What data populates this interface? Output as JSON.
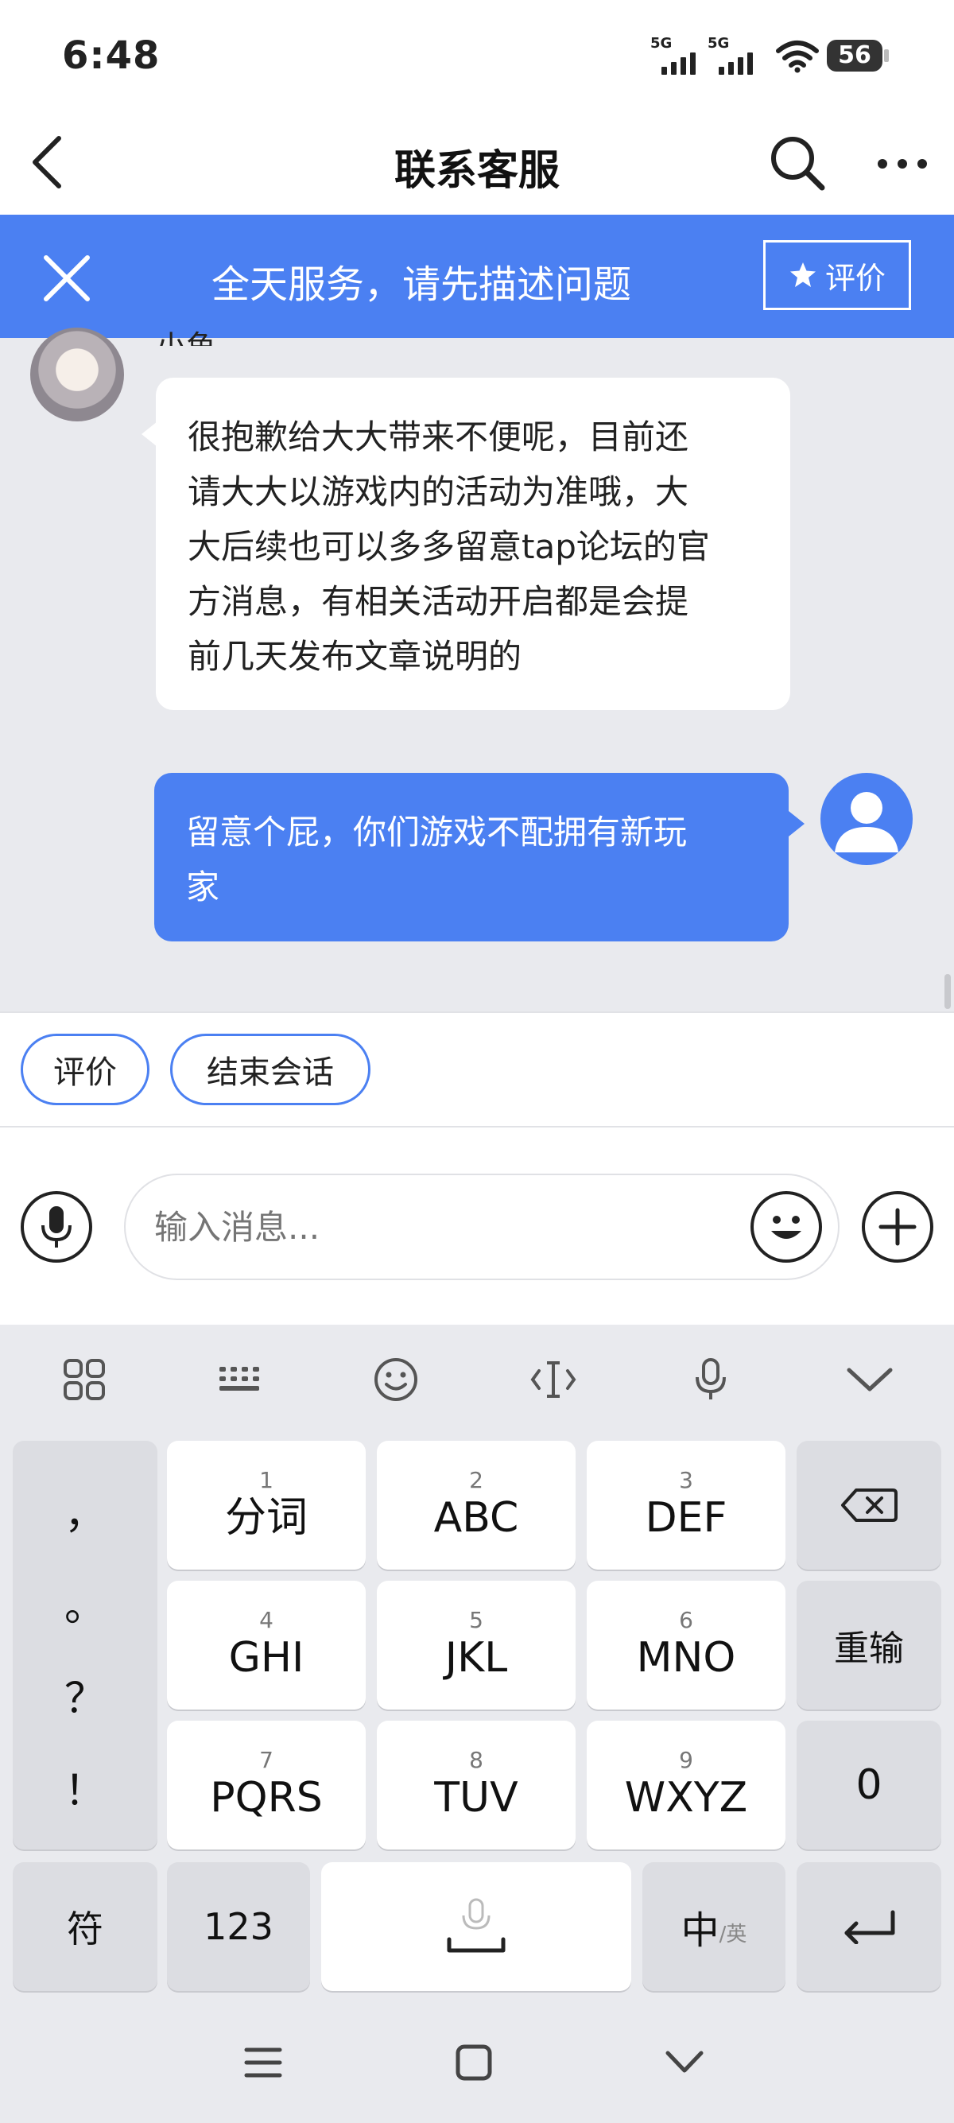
{
  "status_bar": {
    "time": "6:48",
    "signal1": "5G",
    "signal2": "5G",
    "battery": "56"
  },
  "header": {
    "title": "联系客服",
    "back_icon": "chevron-left-icon",
    "search_icon": "search-icon",
    "more_icon": "more-horizontal-icon"
  },
  "banner": {
    "text": "全天服务，请先描述问题",
    "rate_label": "评价"
  },
  "chat": {
    "agent_name": "小鱼",
    "incoming_lines": [
      "很抱歉给大大带来不便呢，目前还",
      "请大大以游戏内的活动为准哦，大",
      "大后续也可以多多留意tap论坛的官",
      "方消息，有相关活动开启都是会提",
      "前几天发布文章说明的"
    ],
    "outgoing_lines": [
      "留意个屁，你们游戏不配拥有新玩",
      "家"
    ]
  },
  "quick_actions": [
    "评价",
    "结束会话"
  ],
  "input": {
    "placeholder": "输入消息..."
  },
  "keyboard": {
    "punct": [
      "，",
      "。",
      "？",
      "！"
    ],
    "row1": [
      {
        "num": "1",
        "label": "分词"
      },
      {
        "num": "2",
        "label": "ABC"
      },
      {
        "num": "3",
        "label": "DEF"
      }
    ],
    "row2": [
      {
        "num": "4",
        "label": "GHI"
      },
      {
        "num": "5",
        "label": "JKL"
      },
      {
        "num": "6",
        "label": "MNO"
      }
    ],
    "row3": [
      {
        "num": "7",
        "label": "PQRS"
      },
      {
        "num": "8",
        "label": "TUV"
      },
      {
        "num": "9",
        "label": "WXYZ"
      }
    ],
    "reinput": "重输",
    "zero": "0",
    "symbol": "符",
    "num123": "123",
    "lang_main": "中",
    "lang_sub": "/英"
  },
  "colors": {
    "accent": "#4b80f2",
    "background": "#e9eaee"
  }
}
